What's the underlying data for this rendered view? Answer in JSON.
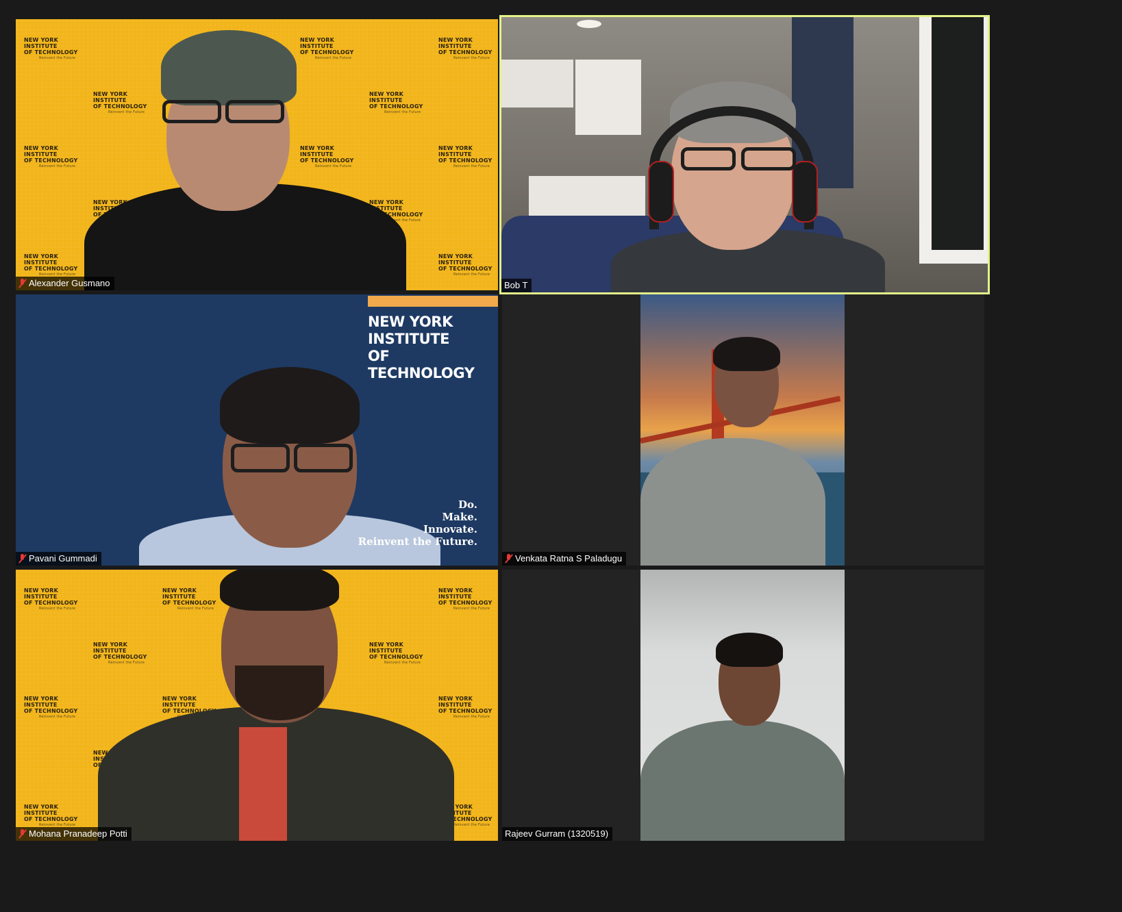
{
  "meeting": {
    "participants": [
      {
        "name": "Alexander Gusmano",
        "muted": true,
        "active_speaker": false,
        "background": "yellow-nyit"
      },
      {
        "name": "Bob T",
        "muted": false,
        "active_speaker": true,
        "background": "home-basement"
      },
      {
        "name": "Pavani Gummadi",
        "muted": true,
        "active_speaker": false,
        "background": "navy-nyit"
      },
      {
        "name": "Venkata Ratna S Paladugu",
        "muted": true,
        "active_speaker": false,
        "background": "golden-gate-bridge"
      },
      {
        "name": "Mohana Pranadeep Potti",
        "muted": true,
        "active_speaker": false,
        "background": "yellow-nyit"
      },
      {
        "name": "Rajeev Gurram (1320519)",
        "muted": false,
        "active_speaker": false,
        "background": "plain-wall"
      }
    ]
  },
  "backdrop": {
    "nyit_logo": "NEW YORK INSTITUTE OF TECHNOLOGY",
    "nyit_logo_line1": "NEW YORK INSTITUTE",
    "nyit_logo_line2": "OF TECHNOLOGY",
    "tagline": "Reinvent the Future",
    "navy_motto": [
      "Do.",
      "Make.",
      "Innovate.",
      "Reinvent the Future."
    ]
  },
  "colors": {
    "active_speaker_border": "#e4f28a",
    "muted_icon": "#e53935",
    "nyit_yellow": "#f2b51c",
    "nyit_navy": "#1e3a63",
    "nyit_orange": "#f0a94b",
    "window_background": "#1a1a1a",
    "tile_background": "#232323"
  }
}
